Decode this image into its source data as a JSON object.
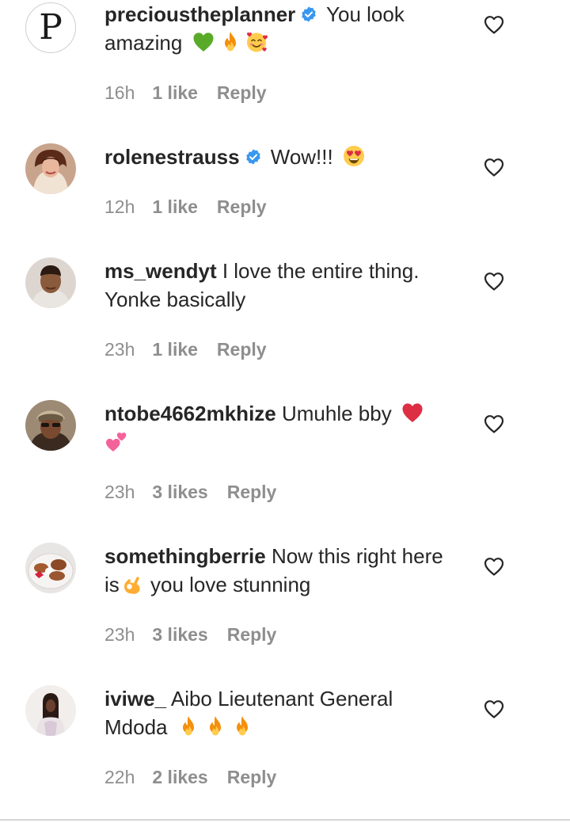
{
  "comments": [
    {
      "username": "precioustheplanner",
      "verified": true,
      "avatar_letter": "P",
      "text": " You look amazing",
      "emojis": [
        "green-heart",
        "fire",
        "smiling-face-with-hearts"
      ],
      "time": "16h",
      "likes": "1 like",
      "reply": "Reply"
    },
    {
      "username": "rolenestrauss",
      "verified": true,
      "text": " Wow!!!",
      "emojis": [
        "heart-eyes"
      ],
      "time": "12h",
      "likes": "1 like",
      "reply": "Reply"
    },
    {
      "username": "ms_wendyt",
      "verified": false,
      "text": " I love the entire thing. Yonke basically",
      "emojis": [],
      "time": "23h",
      "likes": "1 like",
      "reply": "Reply"
    },
    {
      "username": "ntobe4662mkhize",
      "verified": false,
      "text": " Umuhle bby",
      "emojis": [
        "red-heart",
        "two-hearts"
      ],
      "time": "23h",
      "likes": "3 likes",
      "reply": "Reply"
    },
    {
      "username": "somethingberrie",
      "verified": false,
      "text_before": " Now this right here is",
      "text_after": " you love stunning",
      "emojis": [
        "ok-hand"
      ],
      "time": "23h",
      "likes": "3 likes",
      "reply": "Reply"
    },
    {
      "username": "iviwe_",
      "verified": false,
      "text": " Aibo Lieutenant General Mdoda",
      "emojis": [
        "fire",
        "fire",
        "fire"
      ],
      "time": "22h",
      "likes": "2 likes",
      "reply": "Reply"
    }
  ],
  "colors": {
    "text": "#262626",
    "meta": "#8e8e8e",
    "verified_badge": "#3897f0"
  },
  "icons": {
    "like": "heart-outline-icon",
    "verified": "verified-badge-icon"
  }
}
